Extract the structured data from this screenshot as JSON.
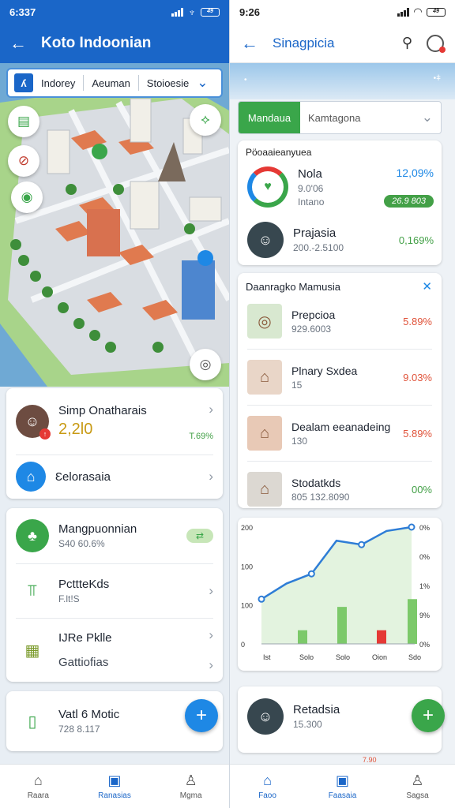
{
  "left": {
    "status": {
      "time": "6:337",
      "battery": "49"
    },
    "appbar": {
      "title": "Koto Indoonian"
    },
    "chipbar": {
      "logo": "ʎ",
      "chips": [
        "Indorey",
        "Aeuman",
        "Stoioesie"
      ]
    },
    "map_icons": [
      "clipboard-icon",
      "no-entry-icon",
      "bus-icon",
      "share-icon",
      "compass-icon"
    ],
    "card1": {
      "user_title": "Simp Onatharais",
      "user_amount": "2,2l0",
      "user_stat": "T.69%",
      "item2_label": "Ɛelorasaia"
    },
    "card2": {
      "item1_title": "Mangpuonnian",
      "item1_sub": "S40 60.6%",
      "item2_title": "PcttteKds",
      "item2_sub": "F.lt!S",
      "item3_title": "IJRe Pklle",
      "item4_title": "Gattiofias"
    },
    "card3": {
      "title": "Vatl 6 Motic",
      "sub": "728 8.117",
      "fab": "+"
    },
    "nav": [
      "Raara",
      "Ranasias",
      "Mgma"
    ]
  },
  "right": {
    "status": {
      "time": "9:26",
      "battery": "49"
    },
    "appbar": {
      "title": "Sinagpicia"
    },
    "tabs": {
      "active": "Mandaua",
      "selected": "Kamtagona"
    },
    "section1": {
      "title": "Pöoaaieanyuea",
      "row1": {
        "title": "Nola",
        "sub1": "9.0'06",
        "sub2": "Intano",
        "pct": "12,09%",
        "pill": "26.9 803"
      },
      "row2": {
        "title": "Prajasia",
        "sub": "200.-2.5100",
        "pct": "0,169%"
      }
    },
    "section2": {
      "title": "Daanragko Mamusia",
      "items": [
        {
          "title": "Prepcioa",
          "sub": "929.6003",
          "pct": "5.89%",
          "color": "#e0533a"
        },
        {
          "title": "Plnary Sxdea",
          "sub": "15",
          "pct": "9.03%",
          "color": "#e0533a"
        },
        {
          "title": "Dealam eeanadeing",
          "sub": "130",
          "pct": "5.89%",
          "color": "#e0533a"
        },
        {
          "title": "Stodatkds",
          "sub": "805 132.8090",
          "pct": "00%",
          "color": "#43a047"
        }
      ]
    },
    "chart_data": {
      "type": "bar",
      "categories": [
        "Ist",
        "Solo",
        "Solo",
        "Oion",
        "Sdo"
      ],
      "values": [
        70,
        0,
        0,
        70,
        0
      ],
      "bar_values": [
        35,
        95,
        35,
        115
      ],
      "line": [
        115,
        155,
        180,
        265,
        255,
        290,
        300
      ],
      "yticks_left": [
        "0",
        "100",
        "100",
        "200"
      ],
      "yticks_right": [
        "0%",
        "9%",
        "1%",
        "0%",
        "0%"
      ],
      "ylim": [
        0,
        300
      ],
      "colors": {
        "bar_green": "#7cc96a",
        "bar_red": "#e53935",
        "line": "#2e7dd6"
      }
    },
    "section4": {
      "title": "Retadsia",
      "sub": "15.300",
      "fab": "+"
    },
    "section5": {
      "label": "7.90"
    },
    "nav": [
      "Faoo",
      "Faasaia",
      "Sagsa"
    ]
  }
}
